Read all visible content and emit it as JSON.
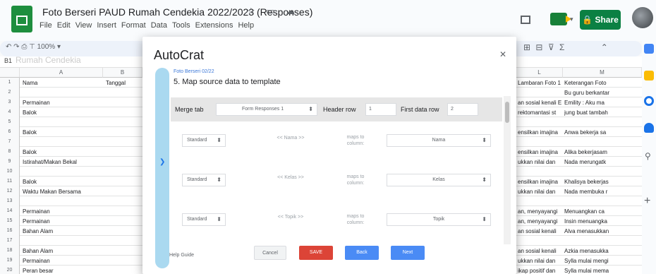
{
  "doc": {
    "title": "Foto Berseri PAUD Rumah Cendekia 2022/2023 (Responses)",
    "menu": [
      "File",
      "Edit",
      "View",
      "Insert",
      "Format",
      "Data",
      "Tools",
      "Extensions",
      "Help"
    ]
  },
  "share": {
    "label": "Share"
  },
  "toolbar": {
    "zoom": "100%",
    "cellref": "B1",
    "faded_text": "Rumah Cendekia"
  },
  "sheet": {
    "left_header_b": "Tanggal",
    "left_rows": [
      {
        "num": "1",
        "a": "Nama",
        "b": "Tanggal"
      },
      {
        "num": "2",
        "a": "",
        "b": ""
      },
      {
        "num": "3",
        "a": "Permainan",
        "b": ""
      },
      {
        "num": "4",
        "a": "Balok",
        "b": ""
      },
      {
        "num": "5",
        "a": "",
        "b": ""
      },
      {
        "num": "6",
        "a": "Balok",
        "b": ""
      },
      {
        "num": "7",
        "a": "",
        "b": ""
      },
      {
        "num": "8",
        "a": "Balok",
        "b": ""
      },
      {
        "num": "9",
        "a": "Istirahat/Makan Bekal",
        "b": ""
      },
      {
        "num": "10",
        "a": "",
        "b": ""
      },
      {
        "num": "11",
        "a": "Balok",
        "b": ""
      },
      {
        "num": "12",
        "a": "Waktu Makan Bersama",
        "b": ""
      },
      {
        "num": "13",
        "a": "",
        "b": ""
      },
      {
        "num": "14",
        "a": "Permainan",
        "b": ""
      },
      {
        "num": "15",
        "a": "Permainan",
        "b": ""
      },
      {
        "num": "16",
        "a": "Bahan Alam",
        "b": ""
      },
      {
        "num": "17",
        "a": "",
        "b": ""
      },
      {
        "num": "18",
        "a": "Bahan Alam",
        "b": ""
      },
      {
        "num": "19",
        "a": "Permainan",
        "b": ""
      },
      {
        "num": "20",
        "a": "Peran besar",
        "b": ""
      }
    ],
    "right_header_l": "L",
    "right_header_m": "M",
    "right_rows": [
      {
        "l": "Lambaran Foto 1",
        "m": "Keterangan Foto"
      },
      {
        "l": "",
        "m": "Bu guru berkantar"
      },
      {
        "l": "an sosial kenali Emosi",
        "m": "Emility : Aku ma"
      },
      {
        "l": "rektomantasi st",
        "m": "jung buat tambah"
      },
      {
        "l": "",
        "m": ""
      },
      {
        "l": "ensilkan imajina",
        "m": "Anwa bekerja sa"
      },
      {
        "l": "",
        "m": ""
      },
      {
        "l": "ensilkan imajina",
        "m": "Alika bekerjasam"
      },
      {
        "l": "ukkan nilai dan",
        "m": "Nada merungatk"
      },
      {
        "l": "",
        "m": ""
      },
      {
        "l": "ensilkan imajina",
        "m": "Khalisya bekerjas"
      },
      {
        "l": "ukkan nilai dan",
        "m": "Nada membuka r"
      },
      {
        "l": "",
        "m": ""
      },
      {
        "l": "an, menyayangi",
        "m": "Menuangkan ca"
      },
      {
        "l": "an, menyayangi",
        "m": "Insin menuangka"
      },
      {
        "l": "an sosial kenali",
        "m": "Alva menasukkan"
      },
      {
        "l": "",
        "m": ""
      },
      {
        "l": "an sosial kenali",
        "m": "Azkia menasukka"
      },
      {
        "l": "ukkan nilai dan",
        "m": "Sylla mulai mengi"
      },
      {
        "l": "ikap positif dan",
        "m": "Sylla mulai mema"
      }
    ]
  },
  "dialog": {
    "title": "AutoCrat",
    "crumb": "Foto Berseri 02/22",
    "step": "5. Map source data to template",
    "merge_tab_label": "Merge tab",
    "merge_tab_value": "Form Responses 1",
    "header_row_label": "Header row",
    "header_row_value": "1",
    "first_data_row_label": "First data row",
    "first_data_row_value": "2",
    "mappings": [
      {
        "mode": "Standard",
        "tag": "<< Nama >>",
        "maps": "maps to column:",
        "column": "Nama"
      },
      {
        "mode": "Standard",
        "tag": "<< Kelas >>",
        "maps": "maps to column:",
        "column": "Kelas"
      },
      {
        "mode": "Standard",
        "tag": "<< Topik >>",
        "maps": "maps to column:",
        "column": "Topik"
      }
    ],
    "help": "Help Guide",
    "buttons": {
      "cancel": "Cancel",
      "save": "SAVE",
      "back": "Back",
      "next": "Next"
    }
  },
  "colors": {
    "share_green": "#0b8043",
    "save_red": "#dc4437",
    "nav_blue": "#4a8bf5",
    "accent_blue": "#aad9f0"
  }
}
